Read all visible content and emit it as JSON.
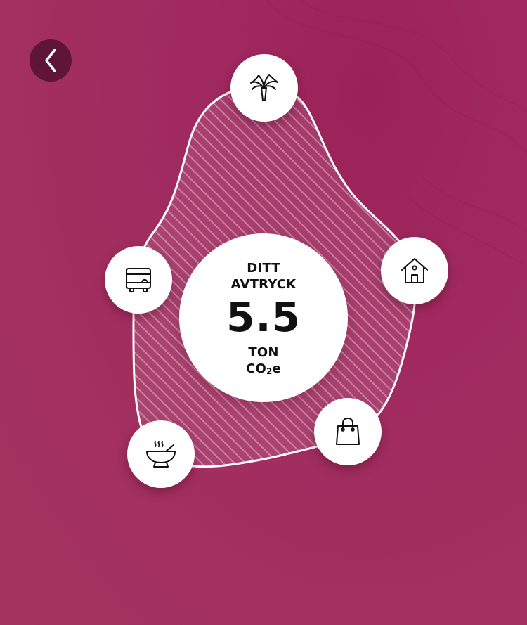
{
  "nav": {
    "back_icon": "chevron-left-icon"
  },
  "footprint": {
    "title_line1": "DITT",
    "title_line2": "AVTRYCK",
    "value": "5.5",
    "unit_line1": "TON",
    "unit_co": "CO",
    "unit_sub": "2",
    "unit_e": "e"
  },
  "categories": [
    {
      "key": "travel",
      "icon": "palm-tree-icon"
    },
    {
      "key": "housing",
      "icon": "house-icon"
    },
    {
      "key": "shopping",
      "icon": "shopping-bag-icon"
    },
    {
      "key": "food",
      "icon": "soup-bowl-icon"
    },
    {
      "key": "transport",
      "icon": "bus-icon"
    }
  ],
  "colors": {
    "background": "#a02a60",
    "back_button": "#5f1537",
    "node": "#ffffff",
    "text": "#111111"
  }
}
